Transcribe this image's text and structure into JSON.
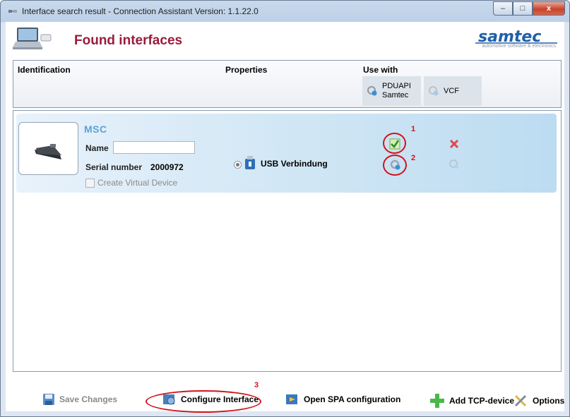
{
  "window": {
    "title": "Interface search result - Connection Assistant Version: 1.1.22.0",
    "controls": {
      "minimize": "–",
      "maximize": "□",
      "close": "x"
    }
  },
  "header": {
    "title": "Found interfaces",
    "logo_text": "samtec",
    "logo_subtitle": "automotive software & electronics"
  },
  "columns": {
    "identification": "Identification",
    "properties": "Properties",
    "use_with": "Use with"
  },
  "use_with_buttons": [
    {
      "label": "PDUAPI\nSamtec",
      "line1": "PDUAPI",
      "line2": "Samtec"
    },
    {
      "label": "VCF"
    }
  ],
  "device": {
    "name": "MSC",
    "name_label": "Name",
    "name_value": "",
    "serial_label": "Serial number",
    "serial_value": "2000972",
    "create_virtual_label": "Create Virtual Device",
    "connection_label": "USB Verbindung"
  },
  "annotations": [
    "1",
    "2",
    "3"
  ],
  "footer": {
    "save": "Save Changes",
    "configure": "Configure Interface",
    "open_spa": "Open SPA configuration",
    "add_tcp": "Add TCP-device",
    "options": "Options"
  },
  "colors": {
    "title_accent": "#9a1b3c",
    "annotation_red": "#d0151b",
    "row_highlight": "#bcdcf1"
  }
}
